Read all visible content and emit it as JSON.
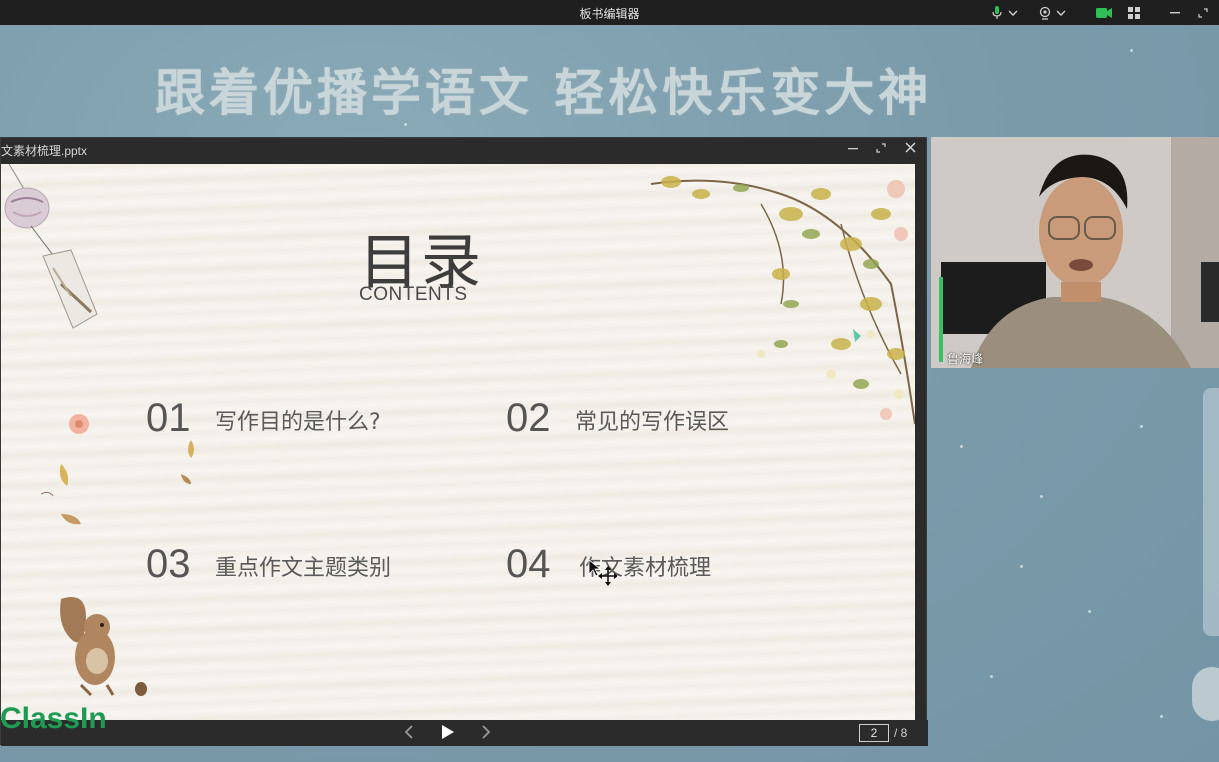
{
  "app": {
    "title": "板书编辑器"
  },
  "topbar": {
    "mic_icon": "microphone-icon",
    "camera_icon": "webcam-icon",
    "video_icon": "video-camera-icon",
    "grid_icon": "grid-icon",
    "minimize_icon": "minimize-icon",
    "restore_icon": "restore-icon"
  },
  "banner": {
    "text": "跟着优播学语文   轻松快乐变大神"
  },
  "ppt_window": {
    "filename": "文素材梳理.pptx",
    "slide": {
      "title_cn": "目录",
      "title_en": "CONTENTS",
      "items": [
        {
          "num": "01",
          "text": "写作目的是什么?"
        },
        {
          "num": "02",
          "text": "常见的写作误区"
        },
        {
          "num": "03",
          "text": "重点作文主题类别"
        },
        {
          "num": "04",
          "text": "作文素材梳理"
        }
      ]
    },
    "pager": {
      "current": "2",
      "total": "/ 8"
    }
  },
  "video": {
    "name": "鲁海峰"
  },
  "brand": {
    "logo_text": "ClassIn",
    "accent": "#1f9a52"
  },
  "colors": {
    "background": "#7f9fad",
    "window": "#2b2b2b",
    "slide_bg": "#f5f2ec"
  }
}
